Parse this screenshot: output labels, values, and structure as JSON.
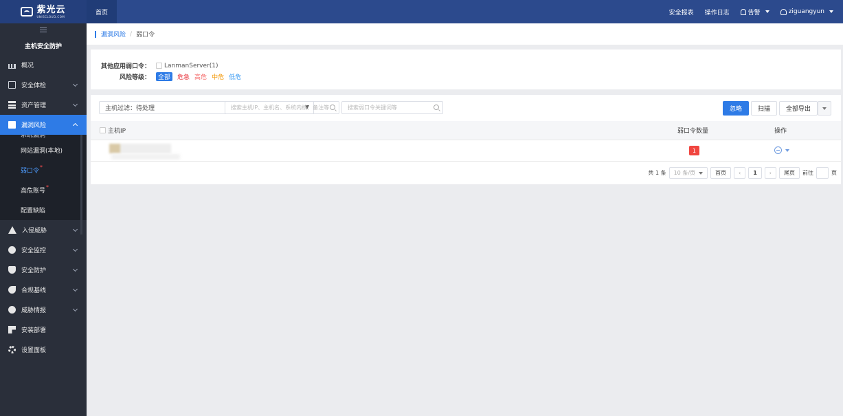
{
  "app": {
    "logo_cn": "紫光云",
    "logo_en": "UNISCLOUD.COM"
  },
  "topbar": {
    "home": "首页",
    "security_report": "安全报表",
    "operation_log": "操作日志",
    "alerts": "告警",
    "user": "ziguangyun"
  },
  "sidebar": {
    "title": "主机安全防护",
    "items": [
      {
        "label": "概况",
        "icon": "bar-chart-icon"
      },
      {
        "label": "安全体检",
        "icon": "checkup-icon"
      },
      {
        "label": "资产管理",
        "icon": "stack-icon"
      },
      {
        "label": "漏洞风险",
        "icon": "gift-icon"
      },
      {
        "label": "入侵威胁",
        "icon": "warning-icon"
      },
      {
        "label": "安全监控",
        "icon": "monitor-icon"
      },
      {
        "label": "安全防护",
        "icon": "shield-icon"
      },
      {
        "label": "合规基线",
        "icon": "leaf-icon"
      },
      {
        "label": "威胁情报",
        "icon": "intel-icon"
      },
      {
        "label": "安装部署",
        "icon": "grid-icon"
      },
      {
        "label": "设置面板",
        "icon": "gear-icon"
      }
    ],
    "sub_cut": "系统漏洞",
    "sub": [
      {
        "label": "网站漏洞(本地)"
      },
      {
        "label": "弱口令",
        "dot": "*"
      },
      {
        "label": "高危账号",
        "dot": "*"
      },
      {
        "label": "配置缺陷"
      }
    ]
  },
  "breadcrumb": {
    "parent": "漏洞风险",
    "sep": "/",
    "current": "弱口令"
  },
  "filters": {
    "other_label": "其他应用弱口令：",
    "other_option": "LanmanServer(1)",
    "risk_label": "风险等级：",
    "risk_levels": [
      "全部",
      "危急",
      "高危",
      "中危",
      "低危"
    ],
    "colors": {
      "all": "#2e7be6",
      "critical": "#e8313a",
      "high": "#f56c6c",
      "medium": "#f39c12",
      "low": "#3d9cf2"
    }
  },
  "toolbar": {
    "host_filter": "主机过滤：待处理",
    "search1_placeholder": "搜索主机IP、主机名、系统内核、备注等",
    "search2_placeholder": "搜索弱口令关键词等",
    "ignore": "忽略",
    "scan": "扫描",
    "export_all": "全部导出"
  },
  "table": {
    "headers": {
      "host_ip": "主机IP",
      "weak_count": "弱口令数量",
      "action": "操作"
    },
    "rows": [
      {
        "weak_count": "1"
      }
    ]
  },
  "pager": {
    "total": "共 1 条",
    "page_size": "10 条/页",
    "first": "首页",
    "prev": "‹",
    "page": "1",
    "next": "›",
    "last": "尾页",
    "goto_label": "前往",
    "page_unit": "页"
  }
}
